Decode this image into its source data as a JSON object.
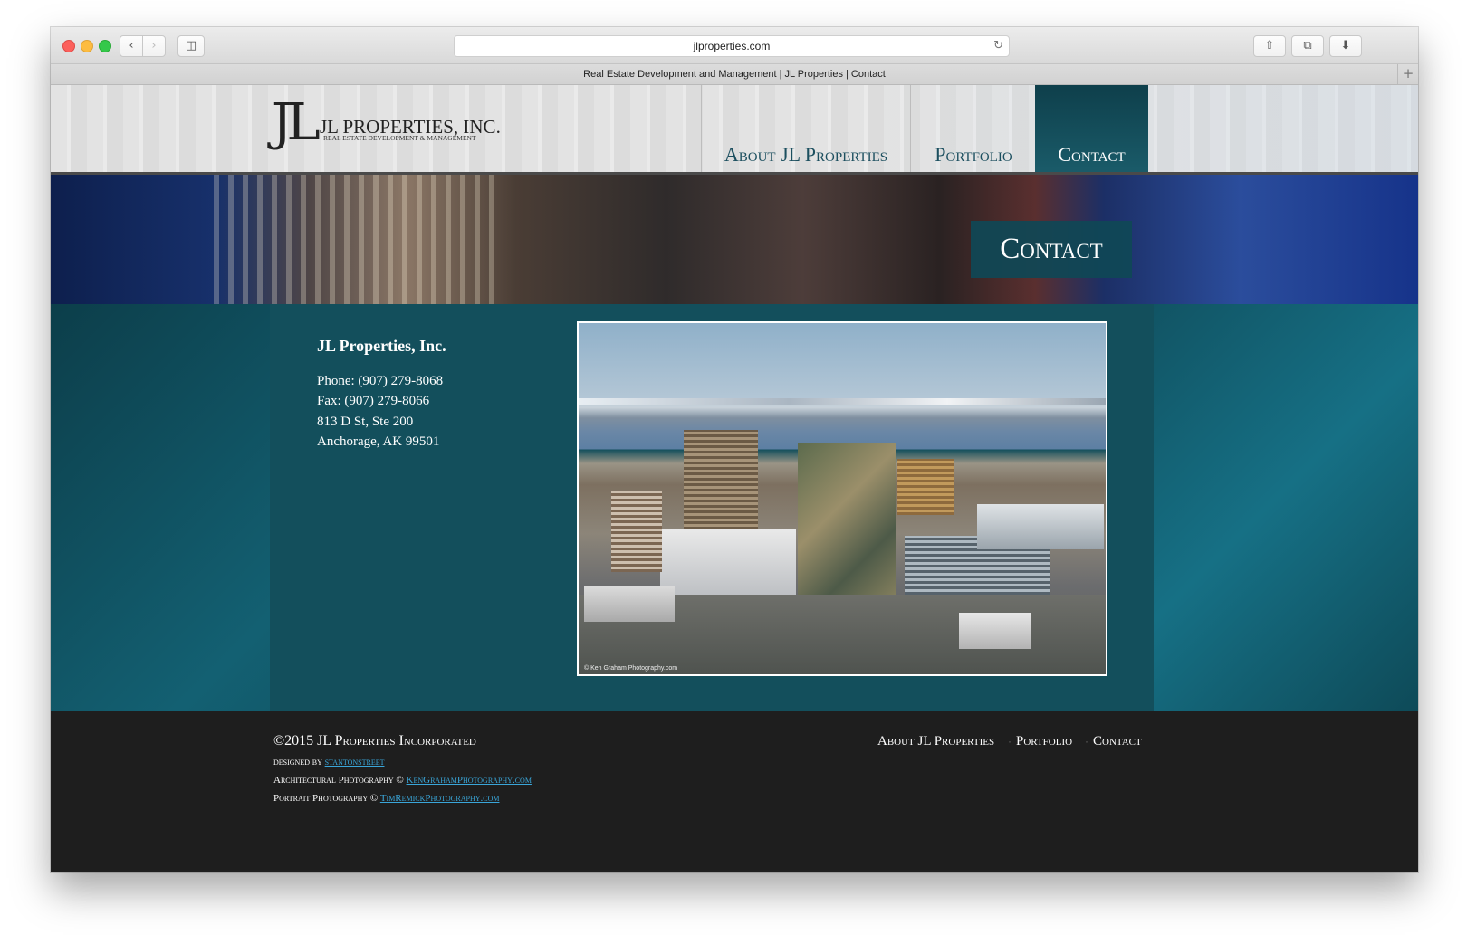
{
  "browser": {
    "url": "jlproperties.com",
    "tab_title": "Real Estate Development and Management | JL Properties | Contact"
  },
  "header": {
    "logo_mark": "JL",
    "logo_name": "JL PROPERTIES, INC.",
    "logo_tagline": "REAL ESTATE DEVELOPMENT & MANAGEMENT",
    "nav": [
      {
        "label": "About JL Properties"
      },
      {
        "label": "Portfolio"
      },
      {
        "label": "Contact"
      }
    ]
  },
  "banner": {
    "title": "Contact"
  },
  "contact": {
    "company": "JL Properties, Inc.",
    "phone": "Phone: (907) 279-8068",
    "fax": "Fax: (907) 279-8066",
    "address1": "813 D St, Ste 200",
    "address2": "Anchorage, AK 99501",
    "photo_credit": "© Ken Graham Photography.com"
  },
  "footer": {
    "copyright": "©2015 JL Properties Incorporated",
    "designed_by_label": "designed by",
    "designed_by_link": "stantonstreet",
    "arch_label": "Architectural Photography ©",
    "arch_link": "KenGrahamPhotography.com",
    "portrait_label": "Portrait Photography ©",
    "portrait_link": "TimRemickPhotography.com",
    "nav": [
      {
        "label": "About JL Properties"
      },
      {
        "label": "Portfolio"
      },
      {
        "label": "Contact"
      }
    ]
  },
  "colors": {
    "teal_dark": "#0e3f4b",
    "teal": "#134f5c",
    "link": "#3aa6d9",
    "footer_bg": "#1e1e1e"
  },
  "icons": [
    "back-icon",
    "forward-icon",
    "sidebar-icon",
    "reload-icon",
    "share-icon",
    "tabs-icon",
    "download-icon",
    "new-tab-icon"
  ]
}
